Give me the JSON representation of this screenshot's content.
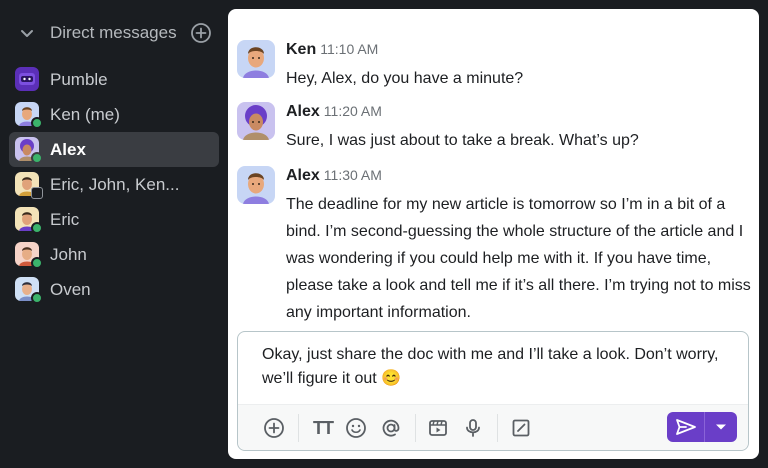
{
  "sidebar": {
    "section_title": "Direct messages",
    "items": [
      {
        "label": "Pumble",
        "avatar": "bot-avatar",
        "status": "none"
      },
      {
        "label": "Ken (me)",
        "avatar": "ken-avatar",
        "status": "online"
      },
      {
        "label": "Alex",
        "avatar": "alex-avatar",
        "status": "online",
        "active": true
      },
      {
        "label": "Eric, John, Ken...",
        "avatar": "group-avatar",
        "status": "group"
      },
      {
        "label": "Eric",
        "avatar": "eric-avatar",
        "status": "online"
      },
      {
        "label": "John",
        "avatar": "john-avatar",
        "status": "online"
      },
      {
        "label": "Oven",
        "avatar": "oven-avatar",
        "status": "online"
      }
    ]
  },
  "messages": [
    {
      "author": "Ken",
      "time": "11:10 AM",
      "text": "Hey, Alex, do you have a minute?"
    },
    {
      "author": "Alex",
      "time": "11:20 AM",
      "text": "Sure, I was just about to take a break. What’s up?"
    },
    {
      "author": "Alex",
      "time": "11:30 AM",
      "text": "The deadline for my new article is tomorrow so I’m in a bit of a bind. I’m second-guessing the whole structure of the article and I was wondering if you could help me with it. If you have time, please take a look and tell me if it’s all there. I’m trying not to miss any important information."
    }
  ],
  "composer": {
    "draft": "Okay, just share the doc with me and I’ll take a look. Don’t worry, we’ll figure it out 😊",
    "toolbar_icons": [
      "plus-circle-icon",
      "text-format-icon",
      "emoji-icon",
      "mention-icon",
      "video-clip-icon",
      "microphone-icon",
      "edit-box-icon"
    ],
    "tt_label": "TT"
  },
  "colors": {
    "sidebar_bg": "#1a1d21",
    "active_item_bg": "#3a3d42",
    "presence_online": "#3bb36b",
    "send_button": "#6a3ec8"
  }
}
